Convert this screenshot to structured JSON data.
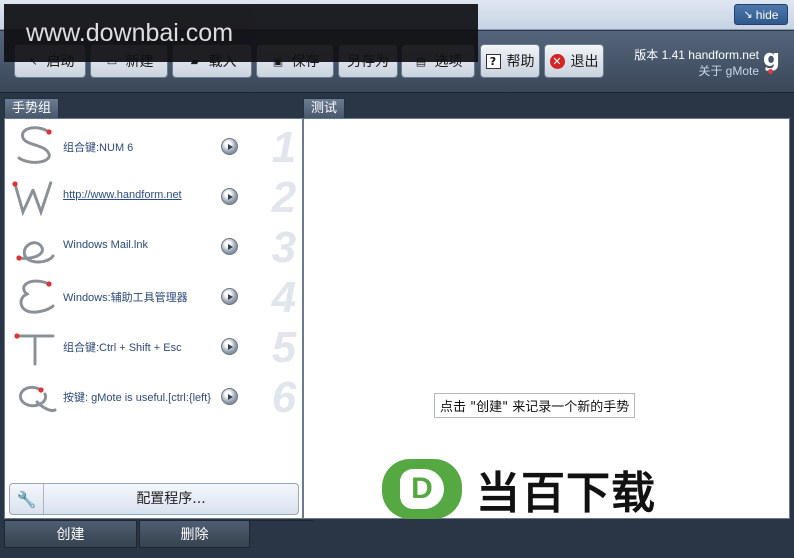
{
  "header": {
    "hide_label": "hide"
  },
  "toolbar": {
    "buttons": [
      {
        "label": "启动",
        "icon": "cursor-icon"
      },
      {
        "label": "新建",
        "icon": "new-file-icon"
      },
      {
        "label": "载入",
        "icon": "open-folder-icon"
      },
      {
        "label": "保存",
        "icon": "save-disk-icon"
      },
      {
        "label": "另存为",
        "icon": "save-as-icon"
      },
      {
        "label": "选项",
        "icon": "options-icon"
      },
      {
        "label": "帮助",
        "icon": "help-icon"
      },
      {
        "label": "退出",
        "icon": "exit-icon"
      }
    ],
    "version": "版本 1.41 handform.net",
    "about": "关于 gMote",
    "logo": "g"
  },
  "watermark": {
    "site": "www.downbai.com",
    "brand": "当百下载",
    "brand_letter": "D",
    "brand_color": "#56a842"
  },
  "left_panel": {
    "title": "手势组",
    "gestures": [
      {
        "glyph": "S",
        "action": "组合键:NUM 6",
        "num": "1",
        "is_link": false
      },
      {
        "glyph": "W",
        "action": "http://www.handform.net",
        "num": "2",
        "is_link": true
      },
      {
        "glyph": "e",
        "action": "Windows Mail.lnk",
        "num": "3",
        "is_link": false
      },
      {
        "glyph": "E",
        "action": "Windows:辅助工具管理器",
        "num": "4",
        "is_link": false
      },
      {
        "glyph": "T",
        "action": "组合键:Ctrl + Shift + Esc",
        "num": "5",
        "is_link": false
      },
      {
        "glyph": "Q",
        "action": "按键: gMote is useful.[ctrl:{left}",
        "num": "6",
        "is_link": false
      }
    ],
    "config_label": "配置程序..."
  },
  "right_panel": {
    "title": "测试",
    "hint": "点击 \"创建\" 来记录一个新的手势"
  },
  "bottom": {
    "create_label": "创建",
    "delete_label": "删除"
  }
}
